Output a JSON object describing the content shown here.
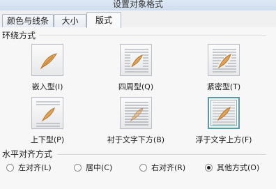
{
  "window": {
    "title": "设置对象格式"
  },
  "tabs": [
    {
      "label": "颜色与线条"
    },
    {
      "label": "大小"
    },
    {
      "label": "版式",
      "active": true
    }
  ],
  "wrap_section": {
    "title": "环绕方式",
    "options": [
      {
        "label": "嵌入型(I)",
        "icon": "inline-wrap-icon"
      },
      {
        "label": "四周型(Q)",
        "icon": "square-wrap-icon"
      },
      {
        "label": "紧密型(T)",
        "icon": "tight-wrap-icon"
      },
      {
        "label": "上下型(P)",
        "icon": "top-bottom-wrap-icon"
      },
      {
        "label": "衬于文字下方(B)",
        "icon": "behind-text-icon"
      },
      {
        "label": "浮于文字上方(F)",
        "icon": "in-front-of-text-icon",
        "selected": true
      }
    ]
  },
  "align_section": {
    "title": "水平对齐方式",
    "options": [
      {
        "label": "左对齐(L)",
        "checked": false
      },
      {
        "label": "居中(C)",
        "checked": false
      },
      {
        "label": "右对齐(R)",
        "checked": false
      },
      {
        "label": "其他方式(O)",
        "checked": true
      }
    ]
  },
  "colors": {
    "accent_selected": "#5a9aa7",
    "feather": "#e0a35a"
  }
}
